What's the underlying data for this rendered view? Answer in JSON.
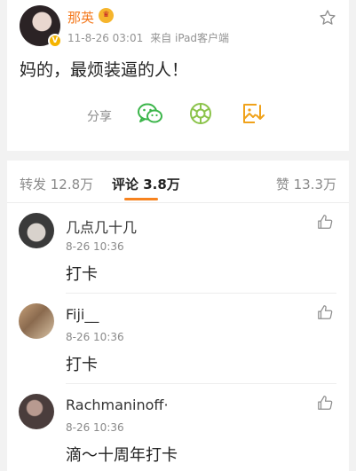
{
  "post": {
    "author_name": "那英",
    "author_badge": "V",
    "crown_badge": "♛",
    "timestamp": "11-8-26 03:01",
    "source": "来自 iPad客户端",
    "text": "妈的，最烦装逼的人！",
    "share_label": "分享",
    "icons": {
      "follow": "star-outline-icon",
      "wechat": "wechat-icon",
      "moments": "wechat-moments-icon",
      "save_image": "save-image-icon"
    }
  },
  "tabs": [
    {
      "label": "转发 12.8万"
    },
    {
      "label": "评论 3.8万"
    },
    {
      "label": "赞 13.3万"
    }
  ],
  "comments": [
    {
      "name": "几点几十几",
      "time": "8-26 10:36",
      "text": "打卡"
    },
    {
      "name": "Fiji__",
      "time": "8-26 10:36",
      "text": "打卡"
    },
    {
      "name": "Rachmaninoff·",
      "time": "8-26 10:36",
      "text": "滴～十周年打卡"
    }
  ],
  "colors": {
    "accent": "#f7831f",
    "author_name": "#f47a1f",
    "wechat_green": "#3bb54a",
    "moments_green": "#8bc34a",
    "save_orange": "#f0a21b"
  }
}
